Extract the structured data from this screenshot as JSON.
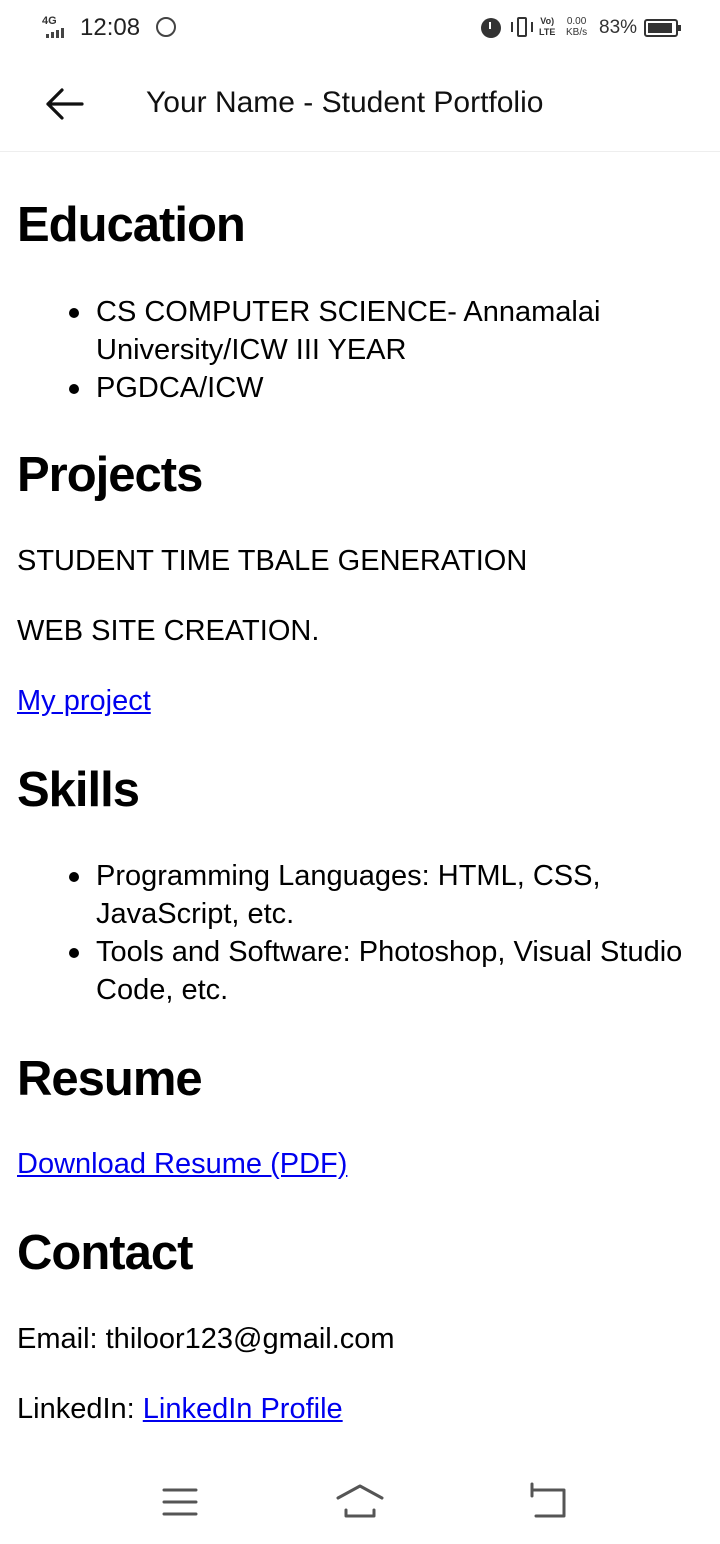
{
  "status_bar": {
    "network": "4G",
    "time": "12:08",
    "volte_top": "Vo)",
    "volte_bottom": "LTE",
    "speed_value": "0.00",
    "speed_unit": "KB/s",
    "battery_percent": "83%"
  },
  "app_bar": {
    "title": "Your Name - Student Portfolio"
  },
  "education": {
    "heading": "Education",
    "items": [
      "CS COMPUTER SCIENCE- Annamalai University/ICW III YEAR",
      "PGDCA/ICW"
    ]
  },
  "projects": {
    "heading": "Projects",
    "lines": [
      "STUDENT TIME TBALE GENERATION",
      "WEB SITE CREATION."
    ],
    "link": "My project"
  },
  "skills": {
    "heading": "Skills",
    "items": [
      "Programming Languages: HTML, CSS, JavaScript, etc.",
      "Tools and Software: Photoshop, Visual Studio Code, etc."
    ]
  },
  "resume": {
    "heading": "Resume",
    "link": "Download Resume (PDF)"
  },
  "contact": {
    "heading": "Contact",
    "email_line": "Email: thiloor123@gmail.com",
    "linkedin_label": "LinkedIn: ",
    "linkedin_link": "LinkedIn Profile"
  },
  "icons": {
    "back": "arrow-left-icon",
    "menu": "menu-icon",
    "home": "home-icon",
    "recents": "return-icon"
  }
}
